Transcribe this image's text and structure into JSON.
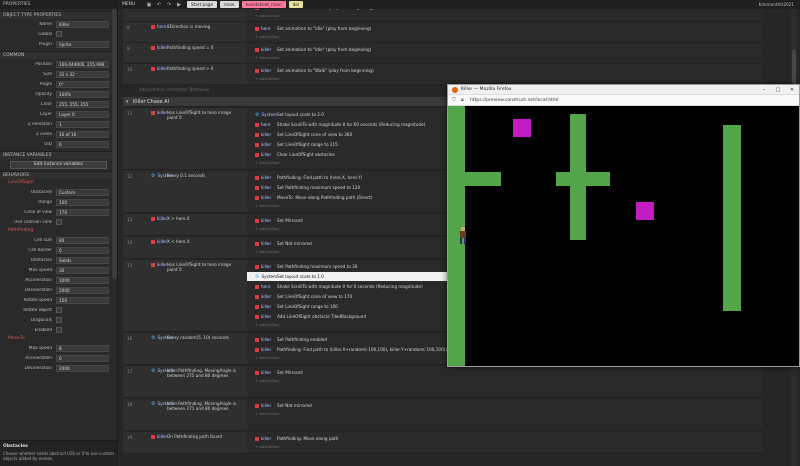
{
  "properties": {
    "panel_title": "PROPERTIES",
    "sections": {
      "object_type": "OBJECT TYPE PROPERTIES",
      "common": "COMMON",
      "instance_vars": "INSTANCE VARIABLES",
      "behaviors": "BEHAVIORS"
    },
    "object_type": [
      {
        "label": "Name",
        "value": "Killer"
      },
      {
        "label": "Global",
        "value": ""
      },
      {
        "label": "Plugin",
        "value": "Sprite"
      }
    ],
    "common": [
      {
        "label": "Position",
        "value": "166.044006, 215.988"
      },
      {
        "label": "Size",
        "value": "32 x 32"
      },
      {
        "label": "Angle",
        "value": "0°"
      },
      {
        "label": "Opacity",
        "value": "100%"
      },
      {
        "label": "Color",
        "value": "255, 255, 255"
      },
      {
        "label": "Layer",
        "value": "Layer 0"
      },
      {
        "label": "Z elevation",
        "value": "1"
      },
      {
        "label": "Z index",
        "value": "16 of 16"
      },
      {
        "label": "UID",
        "value": "6"
      }
    ],
    "edit_instance_vars": "Edit instance variables",
    "behaviors": {
      "los": {
        "name": "LineOfSight",
        "rows": [
          {
            "label": "Obstacles",
            "value": "Custom"
          },
          {
            "label": "Range",
            "value": "100"
          },
          {
            "label": "Cone of view",
            "value": "170"
          },
          {
            "label": "Use collision cells",
            "value": ""
          }
        ]
      },
      "pf": {
        "name": "Pathfinding",
        "rows": [
          {
            "label": "Cell size",
            "value": "80"
          },
          {
            "label": "Cell border",
            "value": "0"
          },
          {
            "label": "Obstacles",
            "value": "Solids"
          },
          {
            "label": "Max speed",
            "value": "30"
          },
          {
            "label": "Acceleration",
            "value": "1000"
          },
          {
            "label": "Deceleration",
            "value": "2000"
          },
          {
            "label": "Rotate speed",
            "value": "150"
          },
          {
            "label": "Rotate object",
            "value": ""
          },
          {
            "label": "Diagonals",
            "value": ""
          },
          {
            "label": "Enabled",
            "value": ""
          }
        ]
      },
      "mv": {
        "name": "MoveTo",
        "rows": [
          {
            "label": "Max speed",
            "value": "8"
          },
          {
            "label": "Acceleration",
            "value": "0"
          },
          {
            "label": "Deceleration",
            "value": "2000"
          }
        ]
      }
    },
    "footer": {
      "title": "Obstacles",
      "desc": "Choose whether solids obstruct LOS or if to use custom objects added by events."
    }
  },
  "topbar": {
    "menu": "MENU",
    "tabs": [
      {
        "label": "Start page",
        "color": "#d9d9d9"
      },
      {
        "label": "main",
        "color": "#d9d9d9"
      },
      {
        "label": "eventsheet_main",
        "color": "#ff7b9a"
      },
      {
        "label": "del",
        "color": "#e6e09a"
      }
    ],
    "user": "Kdemontfdr2021"
  },
  "sheet": {
    "add_action": "+ Add action",
    "top_events": [
      {
        "num": "7",
        "cond_obj": "hero",
        "cond": "8Direction is moving",
        "acts": [
          {
            "obj": "hero",
            "text": "Set animation to \"Walk\" (play from beginning)"
          }
        ]
      },
      {
        "num": "8",
        "cond_obj": "hero",
        "cond": "8Direction is moving",
        "acts": [
          {
            "obj": "hero",
            "text": "Set animation to \"Idle\" (play from beginning)"
          }
        ]
      },
      {
        "num": "9",
        "cond_obj": "killer",
        "cond": "Pathfinding speed = 0",
        "acts": [
          {
            "obj": "killer",
            "text": "Set animation to \"Idle\" (play from beginning)"
          }
        ]
      },
      {
        "num": "10",
        "cond_obj": "killer",
        "cond": "Pathfinding speed > 0",
        "acts": [
          {
            "obj": "killer",
            "text": "Set animation to \"Walk\" (play from beginning)"
          }
        ]
      }
    ],
    "comment": "Add event to 'animation' Behaviour",
    "group": "Killer Chase AI",
    "ev11": {
      "num": "11",
      "cond_obj": "killer",
      "cond": "Has LineOfSight to hero image point 0",
      "acts": [
        {
          "obj": "System",
          "text": "Set layout scale to 2.0"
        },
        {
          "obj": "hero",
          "text": "Shake ScrollTo with magnitude 8 for 60 seconds (Reducing magnitude)"
        },
        {
          "obj": "killer",
          "text": "Set LineOfSight cone of view to 360"
        },
        {
          "obj": "killer",
          "text": "Set LineOfSight range to 215"
        },
        {
          "obj": "killer",
          "text": "Clear LineOfSight obstacles"
        }
      ]
    },
    "ev12": {
      "num": "12",
      "cond_obj": "System",
      "cond": "Every 0.1 seconds",
      "acts": [
        {
          "obj": "killer",
          "text": "Pathfinding: Find path to (hero.X, hero.Y)"
        },
        {
          "obj": "killer",
          "text": "Set Pathfinding maximum speed to 120"
        },
        {
          "obj": "killer",
          "text": "MoveTo: Move along Pathfinding path (Direct)"
        }
      ]
    },
    "ev13": {
      "num": "13",
      "cond_obj": "killer",
      "cond": "X > hero.X",
      "acts": [
        {
          "obj": "killer",
          "text": "Set Mirrored"
        }
      ]
    },
    "ev14": {
      "num": "14",
      "cond_obj": "killer",
      "cond": "X < hero.X",
      "acts": [
        {
          "obj": "killer",
          "text": "Set Not mirrored"
        }
      ]
    },
    "ev15": {
      "num": "15",
      "cond_obj": "killer",
      "cond": "Has LineOfSight to hero image point 0",
      "acts": [
        {
          "obj": "killer",
          "text": "Set Pathfinding maximum speed to 30"
        },
        {
          "obj": "System",
          "text": "Set layout scale to 1.0"
        },
        {
          "obj": "hero",
          "text": "Shake ScrollTo with magnitude 0 for 0 seconds (Reducing magnitude)"
        },
        {
          "obj": "killer",
          "text": "Set LineOfSight cone of view to 170"
        },
        {
          "obj": "killer",
          "text": "Set LineOfSight range to 100"
        },
        {
          "obj": "killer",
          "text": "Add LineOfSight obstacle TiledBackground"
        }
      ]
    },
    "ev16": {
      "num": "16",
      "cond_obj": "System",
      "cond": "Every random(5, 10) seconds",
      "acts": [
        {
          "obj": "killer",
          "text": "Set Pathfinding enabled"
        },
        {
          "obj": "killer",
          "text": "Pathfinding: Find path to (killer.X+random(-100,100), killer.Y+random(-100,100))"
        }
      ]
    },
    "ev17": {
      "num": "17",
      "cond_obj": "System",
      "cond": "killer.Pathfinding. MovingAngle is between 275 and 80 degrees",
      "acts": [
        {
          "obj": "killer",
          "text": "Set Mirrored"
        }
      ]
    },
    "ev18": {
      "num": "18",
      "cond_obj": "System",
      "cond": "killer.Pathfinding. MovingAngle is between 271 and 80 degrees",
      "acts": [
        {
          "obj": "killer",
          "text": "Set Not mirrored"
        }
      ]
    },
    "ev19": {
      "num": "19",
      "cond_obj": "killer",
      "cond": "On Pathfinding path found",
      "acts": [
        {
          "obj": "killer",
          "text": "Pathfinding: Move along path"
        }
      ]
    }
  },
  "firefox": {
    "title": "Killer — Mozilla Firefox",
    "url": "https://preview.construct.net/local.html"
  }
}
